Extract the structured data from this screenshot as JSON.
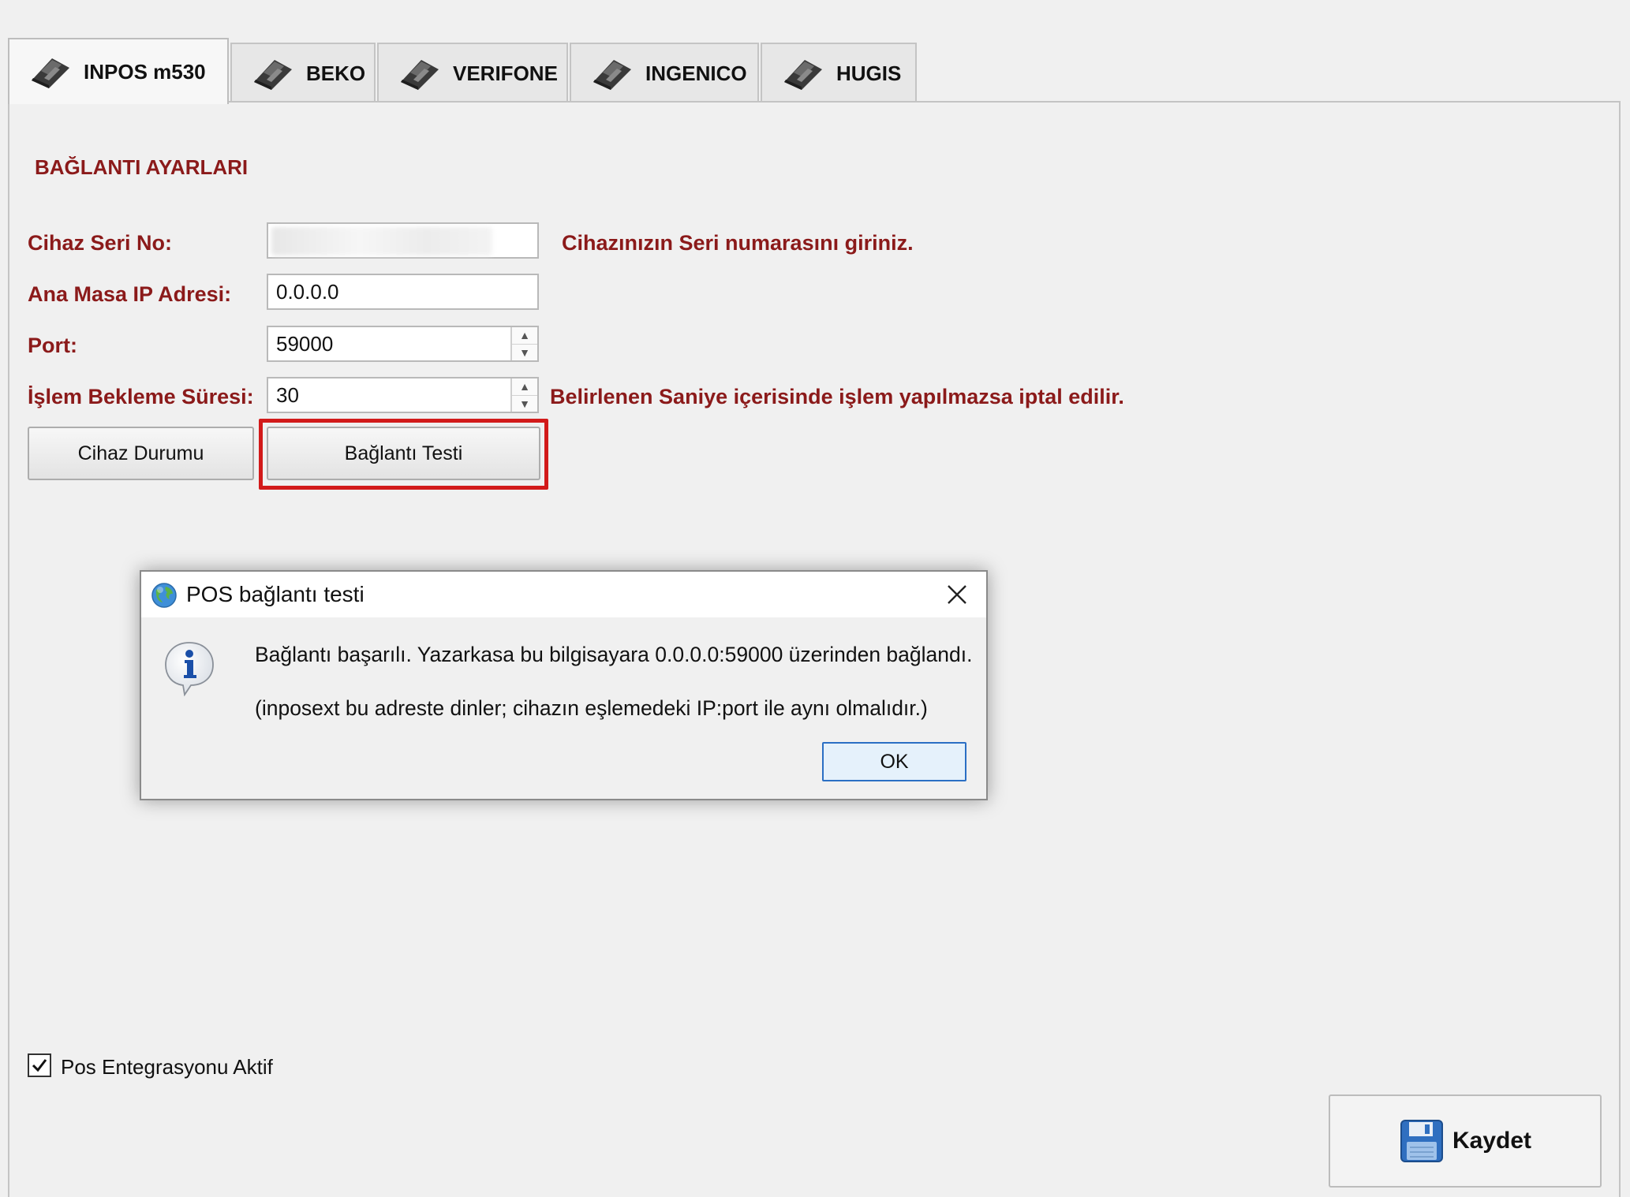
{
  "tabs": [
    {
      "label": "INPOS m530",
      "active": true,
      "icon": "pos-terminal-icon"
    },
    {
      "label": "BEKO",
      "active": false,
      "icon": "pos-terminal-icon"
    },
    {
      "label": "VERIFONE",
      "active": false,
      "icon": "pos-terminal-icon"
    },
    {
      "label": "INGENICO",
      "active": false,
      "icon": "pos-terminal-icon"
    },
    {
      "label": "HUGIS",
      "active": false,
      "icon": "pos-terminal-icon"
    }
  ],
  "settings": {
    "section_title": "BAĞLANTI AYARLARI",
    "serial_label": "Cihaz Seri No:",
    "serial_value": "",
    "serial_hint": "Cihazınızın Seri numarasını giriniz.",
    "ip_label": "Ana Masa IP Adresi:",
    "ip_value": "0.0.0.0",
    "port_label": "Port:",
    "port_value": "59000",
    "timeout_label": "İşlem Bekleme Süresi:",
    "timeout_value": "30",
    "timeout_hint": "Belirlenen Saniye içerisinde işlem yapılmazsa iptal edilir.",
    "device_status_button": "Cihaz Durumu",
    "connection_test_button": "Bağlantı Testi"
  },
  "dialog": {
    "title": "POS bağlantı testi",
    "message_line1": "Bağlantı başarılı. Yazarkasa bu bilgisayara 0.0.0.0:59000 üzerinden bağlandı.",
    "message_line2": "(inposext bu adreste dinler; cihazın eşlemedeki IP:port ile aynı olmalıdır.)",
    "ok_button": "OK"
  },
  "footer": {
    "integration_checkbox_label": "Pos Entegrasyonu Aktif",
    "integration_checked": true,
    "save_button": "Kaydet"
  },
  "colors": {
    "label_red": "#8b1a1a",
    "highlight_red": "#d21a1a",
    "info_blue": "#1a4fa8"
  }
}
